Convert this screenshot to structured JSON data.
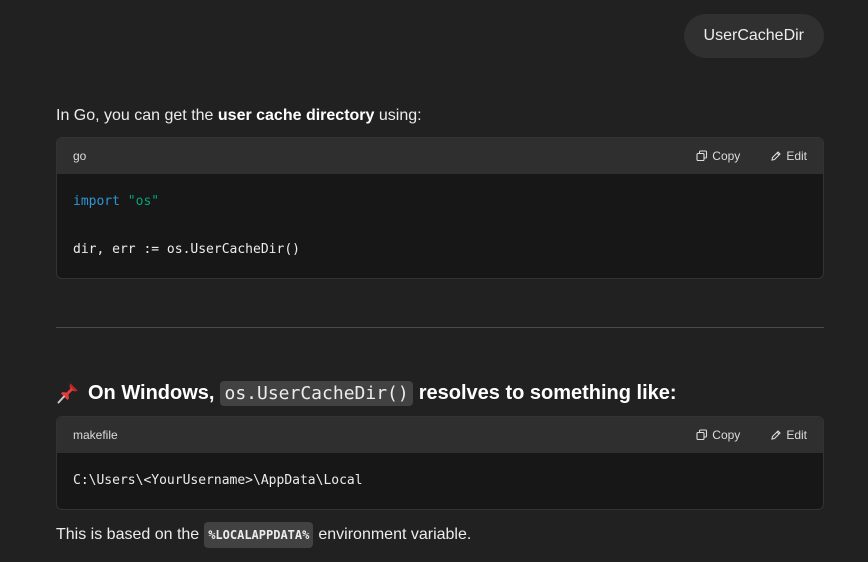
{
  "user_message": "UserCacheDir",
  "intro": {
    "before": "In Go, you can get the ",
    "bold": "user cache directory",
    "after": " using:"
  },
  "code_block_1": {
    "language": "go",
    "copy_label": "Copy",
    "edit_label": "Edit",
    "import_kw": "import",
    "import_str": "\"os\"",
    "line2": "dir, err := os.UserCacheDir()"
  },
  "heading": {
    "before": "On Windows,",
    "code": "os.UserCacheDir()",
    "after": "resolves to something like:"
  },
  "code_block_2": {
    "language": "makefile",
    "copy_label": "Copy",
    "edit_label": "Edit",
    "line1": "C:\\Users\\<YourUsername>\\AppData\\Local"
  },
  "footer": {
    "before": "This is based on the",
    "code": "%LOCALAPPDATA%",
    "after": "environment variable."
  },
  "colors": {
    "background": "#212121",
    "bubble": "#303030",
    "code_header": "#2f2f2f",
    "code_body": "#171717",
    "keyword": "#2e95d3",
    "string": "#00a67d"
  }
}
